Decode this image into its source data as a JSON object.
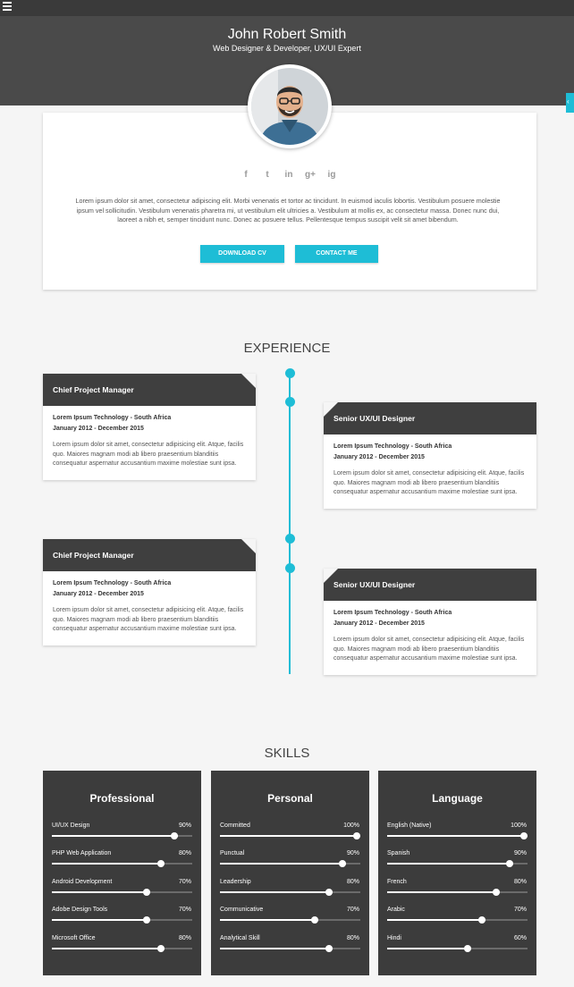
{
  "profile": {
    "name": "John Robert Smith",
    "tagline": "Web Designer & Developer, UX/UI Expert",
    "bio": "Lorem ipsum dolor sit amet, consectetur adipiscing elit. Morbi venenatis et tortor ac tincidunt. In euismod iaculis lobortis. Vestibulum posuere molestie ipsum vel sollicitudin. Vestibulum venenatis pharetra mi, ut vestibulum elit ultricies a. Vestibulum at mollis ex, ac consectetur massa. Donec nunc dui, laoreet a nibh et, semper tincidunt nunc. Donec ac posuere tellus. Pellentesque tempus suscipit velit sit amet bibendum.",
    "download_label": "DOWNLOAD CV",
    "contact_label": "CONTACT ME",
    "social": [
      "f",
      "t",
      "in",
      "g+",
      "ig"
    ]
  },
  "experience": {
    "title": "EXPERIENCE",
    "jobs": [
      {
        "title": "Chief Project Manager",
        "company": "Lorem Ipsum Technology - South Africa",
        "dates": "January 2012 - December 2015",
        "desc": "Lorem ipsum dolor sit amet, consectetur adipisicing elit. Atque, facilis quo. Maiores magnam modi ab libero praesentium blanditiis consequatur aspernatur accusantium maxime molestiae sunt ipsa."
      },
      {
        "title": "Senior UX/UI Designer",
        "company": "Lorem Ipsum Technology - South Africa",
        "dates": "January 2012 - December 2015",
        "desc": "Lorem ipsum dolor sit amet, consectetur adipisicing elit. Atque, facilis quo. Maiores magnam modi ab libero praesentium blanditiis consequatur aspernatur accusantium maxime molestiae sunt ipsa."
      },
      {
        "title": "Chief Project Manager",
        "company": "Lorem Ipsum Technology - South Africa",
        "dates": "January 2012 - December 2015",
        "desc": "Lorem ipsum dolor sit amet, consectetur adipisicing elit. Atque, facilis quo. Maiores magnam modi ab libero praesentium blanditiis consequatur aspernatur accusantium maxime molestiae sunt ipsa."
      },
      {
        "title": "Senior UX/UI Designer",
        "company": "Lorem Ipsum Technology - South Africa",
        "dates": "January 2012 - December 2015",
        "desc": "Lorem ipsum dolor sit amet, consectetur adipisicing elit. Atque, facilis quo. Maiores magnam modi ab libero praesentium blanditiis consequatur aspernatur accusantium maxime molestiae sunt ipsa."
      }
    ]
  },
  "skills": {
    "title": "SKILLS",
    "groups": [
      {
        "title": "Professional",
        "items": [
          {
            "name": "UI/UX Design",
            "percent": "90%",
            "level": 0.9
          },
          {
            "name": "PHP Web Application",
            "percent": "80%",
            "level": 0.8
          },
          {
            "name": "Android Development",
            "percent": "70%",
            "level": 0.7
          },
          {
            "name": "Adobe Design Tools",
            "percent": "70%",
            "level": 0.7
          },
          {
            "name": "Microsoft Office",
            "percent": "80%",
            "level": 0.8
          }
        ]
      },
      {
        "title": "Personal",
        "items": [
          {
            "name": "Committed",
            "percent": "100%",
            "level": 1.0
          },
          {
            "name": "Punctual",
            "percent": "90%",
            "level": 0.9
          },
          {
            "name": "Leadership",
            "percent": "80%",
            "level": 0.8
          },
          {
            "name": "Communicative",
            "percent": "70%",
            "level": 0.7
          },
          {
            "name": "Analytical Skill",
            "percent": "80%",
            "level": 0.8
          }
        ]
      },
      {
        "title": "Language",
        "items": [
          {
            "name": "English (Native)",
            "percent": "100%",
            "level": 1.0
          },
          {
            "name": "Spanish",
            "percent": "90%",
            "level": 0.9
          },
          {
            "name": "French",
            "percent": "80%",
            "level": 0.8
          },
          {
            "name": "Arabic",
            "percent": "70%",
            "level": 0.7
          },
          {
            "name": "Hindi",
            "percent": "60%",
            "level": 0.6
          }
        ]
      }
    ]
  },
  "colors": {
    "accent": "#1ebdd6",
    "dark": "#3c3c3c",
    "header": "#4a4a4a"
  }
}
